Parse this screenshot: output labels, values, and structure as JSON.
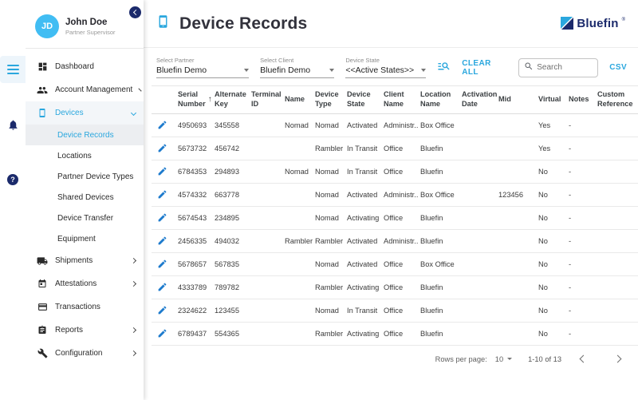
{
  "colors": {
    "accent_blue": "#2aa7de",
    "brand_navy": "#1b2a6b",
    "pencil_blue": "#1e7bcd",
    "avatar_blue": "#41bdf3"
  },
  "sidebar": {
    "user": {
      "initials": "JD",
      "name": "John Doe",
      "role": "Partner Supervisor"
    },
    "nav": {
      "dashboard": {
        "label": "Dashboard"
      },
      "account_management": {
        "label": "Account Management"
      },
      "devices": {
        "label": "Devices"
      },
      "shipments": {
        "label": "Shipments"
      },
      "attestations": {
        "label": "Attestations"
      },
      "transactions": {
        "label": "Transactions"
      },
      "reports": {
        "label": "Reports"
      },
      "configuration": {
        "label": "Configuration"
      }
    },
    "device_children": [
      {
        "label": "Device Records",
        "active": true
      },
      {
        "label": "Locations"
      },
      {
        "label": "Partner Device Types"
      },
      {
        "label": "Shared Devices"
      },
      {
        "label": "Device Transfer"
      },
      {
        "label": "Equipment"
      }
    ]
  },
  "header": {
    "title": "Device Records",
    "brand": "Bluefin",
    "brand_reg": "®"
  },
  "filters": {
    "partner": {
      "label": "Select Partner",
      "value": "Bluefin Demo"
    },
    "client": {
      "label": "Select Client",
      "value": "Bluefin Demo"
    },
    "device_state": {
      "label": "Device State",
      "value": "<<Active States>>"
    },
    "clear_all_label": "CLEAR ALL",
    "search_placeholder": "Search",
    "csv_label": "CSV"
  },
  "table": {
    "columns": [
      {
        "key": "serial",
        "line1": "Serial",
        "line2": "Number",
        "sorted": true
      },
      {
        "key": "alt_key",
        "line1": "Alternate",
        "line2": "Key"
      },
      {
        "key": "terminal_id",
        "line1": "Terminal",
        "line2": "ID"
      },
      {
        "key": "name",
        "line1": "Name",
        "line2": ""
      },
      {
        "key": "device_type",
        "line1": "Device",
        "line2": "Type"
      },
      {
        "key": "device_state",
        "line1": "Device",
        "line2": "State"
      },
      {
        "key": "client_name",
        "line1": "Client",
        "line2": "Name"
      },
      {
        "key": "location_name",
        "line1": "Location",
        "line2": "Name"
      },
      {
        "key": "activation_date",
        "line1": "Activation",
        "line2": "Date"
      },
      {
        "key": "mid",
        "line1": "Mid",
        "line2": ""
      },
      {
        "key": "virtual",
        "line1": "Virtual",
        "line2": ""
      },
      {
        "key": "notes",
        "line1": "Notes",
        "line2": ""
      },
      {
        "key": "custom_ref",
        "line1": "Custom",
        "line2": "Reference"
      }
    ],
    "rows": [
      {
        "serial": "4950693",
        "alt_key": "345558",
        "terminal_id": "",
        "name": "Nomad",
        "device_type": "Nomad",
        "device_state": "Activated",
        "client_name": "Administr...",
        "location_name": "Box Office",
        "activation_date": "",
        "mid": "",
        "virtual": "Yes",
        "notes": "-",
        "custom_ref": ""
      },
      {
        "serial": "5673732",
        "alt_key": "456742",
        "terminal_id": "",
        "name": "",
        "device_type": "Rambler",
        "device_state": "In Transit",
        "client_name": "Office",
        "location_name": "Bluefin",
        "activation_date": "",
        "mid": "",
        "virtual": "Yes",
        "notes": "-",
        "custom_ref": ""
      },
      {
        "serial": "6784353",
        "alt_key": "294893",
        "terminal_id": "",
        "name": "Nomad",
        "device_type": "Nomad",
        "device_state": "In Transit",
        "client_name": "Office",
        "location_name": "Bluefin",
        "activation_date": "",
        "mid": "",
        "virtual": "No",
        "notes": "-",
        "custom_ref": ""
      },
      {
        "serial": "4574332",
        "alt_key": "663778",
        "terminal_id": "",
        "name": "",
        "device_type": "Nomad",
        "device_state": "Activated",
        "client_name": "Administr...",
        "location_name": "Box Office",
        "activation_date": "",
        "mid": "123456",
        "virtual": "No",
        "notes": "-",
        "custom_ref": ""
      },
      {
        "serial": "5674543",
        "alt_key": "234895",
        "terminal_id": "",
        "name": "",
        "device_type": "Nomad",
        "device_state": "Activating",
        "client_name": "Office",
        "location_name": "Bluefin",
        "activation_date": "",
        "mid": "",
        "virtual": "No",
        "notes": "-",
        "custom_ref": ""
      },
      {
        "serial": "2456335",
        "alt_key": "494032",
        "terminal_id": "",
        "name": "Rambler",
        "device_type": "Rambler",
        "device_state": "Activated",
        "client_name": "Administr...",
        "location_name": "Bluefin",
        "activation_date": "",
        "mid": "",
        "virtual": "No",
        "notes": "-",
        "custom_ref": ""
      },
      {
        "serial": "5678657",
        "alt_key": "567835",
        "terminal_id": "",
        "name": "",
        "device_type": "Nomad",
        "device_state": "Activated",
        "client_name": "Office",
        "location_name": "Box Office",
        "activation_date": "",
        "mid": "",
        "virtual": "No",
        "notes": "-",
        "custom_ref": ""
      },
      {
        "serial": "4333789",
        "alt_key": "789782",
        "terminal_id": "",
        "name": "",
        "device_type": "Rambler",
        "device_state": "Activating",
        "client_name": "Office",
        "location_name": "Bluefin",
        "activation_date": "",
        "mid": "",
        "virtual": "No",
        "notes": "-",
        "custom_ref": ""
      },
      {
        "serial": "2324622",
        "alt_key": "123455",
        "terminal_id": "",
        "name": "",
        "device_type": "Nomad",
        "device_state": "In Transit",
        "client_name": "Office",
        "location_name": "Bluefin",
        "activation_date": "",
        "mid": "",
        "virtual": "No",
        "notes": "-",
        "custom_ref": ""
      },
      {
        "serial": "6789437",
        "alt_key": "554365",
        "terminal_id": "",
        "name": "",
        "device_type": "Rambler",
        "device_state": "Activating",
        "client_name": "Office",
        "location_name": "Bluefin",
        "activation_date": "",
        "mid": "",
        "virtual": "No",
        "notes": "-",
        "custom_ref": ""
      }
    ]
  },
  "pagination": {
    "rows_per_page_label": "Rows per page:",
    "rows_per_page_value": "10",
    "range_label": "1-10 of 13"
  }
}
